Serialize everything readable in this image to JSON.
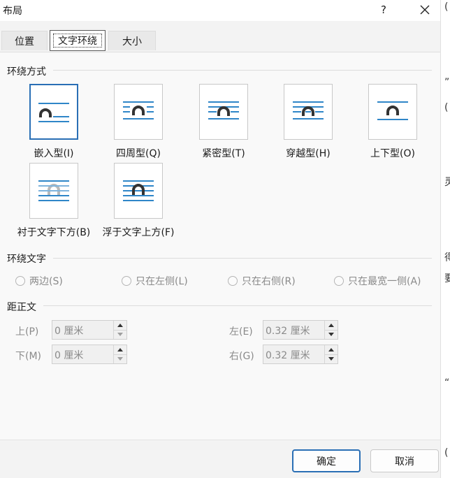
{
  "window": {
    "title": "布局",
    "help_label": "?"
  },
  "tabs": [
    {
      "label": "位置"
    },
    {
      "label": "文字环绕"
    },
    {
      "label": "大小"
    }
  ],
  "wrap_style": {
    "heading": "环绕方式",
    "options": [
      {
        "label": "嵌入型(I)"
      },
      {
        "label": "四周型(Q)"
      },
      {
        "label": "紧密型(T)"
      },
      {
        "label": "穿越型(H)"
      },
      {
        "label": "上下型(O)"
      },
      {
        "label": "衬于文字下方(B)"
      },
      {
        "label": "浮于文字上方(F)"
      }
    ],
    "selected": "嵌入型(I)"
  },
  "wrap_text": {
    "heading": "环绕文字",
    "options": [
      {
        "label": "两边(S)"
      },
      {
        "label": "只在左侧(L)"
      },
      {
        "label": "只在右侧(R)"
      },
      {
        "label": "只在最宽一侧(A)"
      }
    ]
  },
  "distance": {
    "heading": "距正文",
    "top": {
      "label": "上(P)",
      "value": "0 厘米"
    },
    "bottom": {
      "label": "下(M)",
      "value": "0 厘米"
    },
    "left": {
      "label": "左(E)",
      "value": "0.32 厘米"
    },
    "right": {
      "label": "右(G)",
      "value": "0.32 厘米"
    }
  },
  "buttons": {
    "ok": "确定",
    "cancel": "取消"
  },
  "background_peek": [
    "(",
    "”",
    "(",
    "灵",
    "得",
    "要",
    "“",
    "("
  ],
  "colors": {
    "accent": "#2a6fb5",
    "line": "#2f86c8",
    "shape": "#333333",
    "ghost": "#b9b9b9"
  }
}
